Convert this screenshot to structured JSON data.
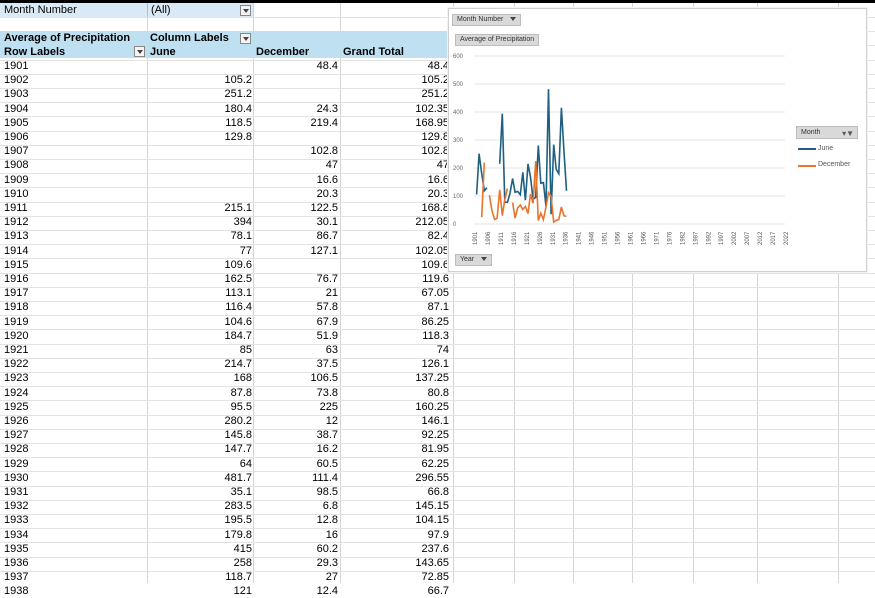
{
  "sheet": {
    "filter": {
      "label": "Month Number",
      "value": "(All)"
    },
    "pivot": {
      "value_label": "Average of Precipitation",
      "column_labels": "Column Labels",
      "row_labels": "Row Labels",
      "columns": [
        "June",
        "December",
        "Grand Total"
      ],
      "rows": [
        [
          "1901",
          "",
          "48.4",
          "48.4"
        ],
        [
          "1902",
          "105.2",
          "",
          "105.2"
        ],
        [
          "1903",
          "251.2",
          "",
          "251.2"
        ],
        [
          "1904",
          "180.4",
          "24.3",
          "102.35"
        ],
        [
          "1905",
          "118.5",
          "219.4",
          "168.95"
        ],
        [
          "1906",
          "129.8",
          "",
          "129.8"
        ],
        [
          "1907",
          "",
          "102.8",
          "102.8"
        ],
        [
          "1908",
          "",
          "47",
          "47"
        ],
        [
          "1909",
          "",
          "16.6",
          "16.6"
        ],
        [
          "1910",
          "",
          "20.3",
          "20.3"
        ],
        [
          "1911",
          "215.1",
          "122.5",
          "168.8"
        ],
        [
          "1912",
          "394",
          "30.1",
          "212.05"
        ],
        [
          "1913",
          "78.1",
          "86.7",
          "82.4"
        ],
        [
          "1914",
          "77",
          "127.1",
          "102.05"
        ],
        [
          "1915",
          "109.6",
          "",
          "109.6"
        ],
        [
          "1916",
          "162.5",
          "76.7",
          "119.6"
        ],
        [
          "1917",
          "113.1",
          "21",
          "67.05"
        ],
        [
          "1918",
          "116.4",
          "57.8",
          "87.1"
        ],
        [
          "1919",
          "104.6",
          "67.9",
          "86.25"
        ],
        [
          "1920",
          "184.7",
          "51.9",
          "118.3"
        ],
        [
          "1921",
          "85",
          "63",
          "74"
        ],
        [
          "1922",
          "214.7",
          "37.5",
          "126.1"
        ],
        [
          "1923",
          "168",
          "106.5",
          "137.25"
        ],
        [
          "1924",
          "87.8",
          "73.8",
          "80.8"
        ],
        [
          "1925",
          "95.5",
          "225",
          "160.25"
        ],
        [
          "1926",
          "280.2",
          "12",
          "146.1"
        ],
        [
          "1927",
          "145.8",
          "38.7",
          "92.25"
        ],
        [
          "1928",
          "147.7",
          "16.2",
          "81.95"
        ],
        [
          "1929",
          "64",
          "60.5",
          "62.25"
        ],
        [
          "1930",
          "481.7",
          "111.4",
          "296.55"
        ],
        [
          "1931",
          "35.1",
          "98.5",
          "66.8"
        ],
        [
          "1932",
          "283.5",
          "6.8",
          "145.15"
        ],
        [
          "1933",
          "195.5",
          "12.8",
          "104.15"
        ],
        [
          "1934",
          "179.8",
          "16",
          "97.9"
        ],
        [
          "1935",
          "415",
          "60.2",
          "237.6"
        ],
        [
          "1936",
          "258",
          "29.3",
          "143.65"
        ],
        [
          "1937",
          "118.7",
          "27",
          "72.85"
        ]
      ],
      "partial_row": [
        "1938",
        "121",
        "12.4",
        "66.7"
      ]
    }
  },
  "chart": {
    "month_chip": "Month Number",
    "measure_chip": "Average of Precipitation",
    "axis_chip": "Year",
    "legend_title": "Month",
    "colors": {
      "June": "#1f5f7f",
      "December": "#e8742e",
      "grid": "#e4e4e4"
    }
  },
  "chart_data": {
    "type": "line",
    "ylim": [
      0,
      600
    ],
    "yticks": [
      0,
      100,
      200,
      300,
      400,
      500,
      600
    ],
    "x_tick_labels": [
      "1901",
      "1906",
      "1911",
      "1916",
      "1921",
      "1926",
      "1931",
      "1936",
      "1941",
      "1946",
      "1951",
      "1956",
      "1961",
      "1966",
      "1971",
      "1976",
      "1982",
      "1987",
      "1992",
      "1997",
      "2002",
      "2007",
      "2012",
      "2017",
      "2022"
    ],
    "x": [
      "1901",
      "1902",
      "1903",
      "1904",
      "1905",
      "1906",
      "1907",
      "1908",
      "1909",
      "1910",
      "1911",
      "1912",
      "1913",
      "1914",
      "1915",
      "1916",
      "1917",
      "1918",
      "1919",
      "1920",
      "1921",
      "1922",
      "1923",
      "1924",
      "1925",
      "1926",
      "1927",
      "1928",
      "1929",
      "1930",
      "1931",
      "1932",
      "1933",
      "1934",
      "1935",
      "1936",
      "1937"
    ],
    "series": [
      {
        "name": "June",
        "values": [
          null,
          105.2,
          251.2,
          180.4,
          118.5,
          129.8,
          null,
          null,
          null,
          null,
          215.1,
          394,
          78.1,
          77,
          109.6,
          162.5,
          113.1,
          116.4,
          104.6,
          184.7,
          85,
          214.7,
          168,
          87.8,
          95.5,
          280.2,
          145.8,
          147.7,
          64,
          481.7,
          35.1,
          283.5,
          195.5,
          179.8,
          415,
          258,
          118.7
        ]
      },
      {
        "name": "December",
        "values": [
          48.4,
          null,
          null,
          24.3,
          219.4,
          null,
          102.8,
          47,
          16.6,
          20.3,
          122.5,
          30.1,
          86.7,
          127.1,
          null,
          76.7,
          21,
          57.8,
          67.9,
          51.9,
          63,
          37.5,
          106.5,
          73.8,
          225,
          12,
          38.7,
          16.2,
          60.5,
          111.4,
          98.5,
          6.8,
          12.8,
          16,
          60.2,
          29.3,
          27
        ]
      }
    ]
  }
}
